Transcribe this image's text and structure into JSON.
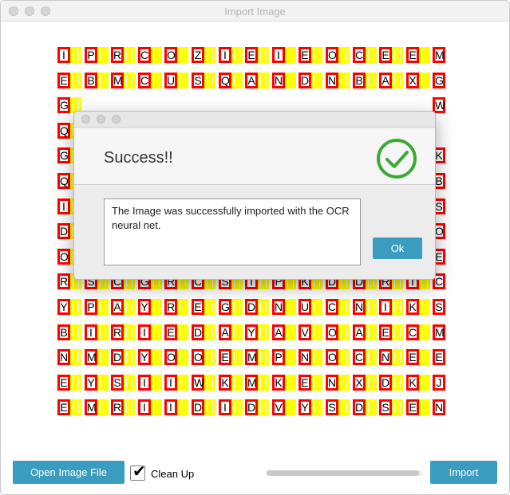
{
  "window": {
    "title": "Import Image"
  },
  "image_grid": {
    "rows": [
      "IPRCOZIEIEOCEEM",
      "EBMCUSQANDNBAXG",
      "GPIISNOGOGEWKW",
      "Q",
      "GK",
      "QB",
      "IS",
      "DO",
      "OE",
      "RSCGRCSIPKDDRIC",
      "YPAYREGDNUCNIKS",
      "BIRIEDAYAVOAECM",
      "NMDYOOEMPNOCNEE",
      "EYSIIWKMKENXDKJ",
      "EMRIIDIDVYSDSEN"
    ],
    "colors": {
      "letter_border": "#ff0000",
      "space_border": "#ffff00"
    }
  },
  "dialog": {
    "heading": "Success!!",
    "message": "The Image was successfully imported with the OCR neural net.",
    "ok_label": "Ok",
    "icon": "check-circle-icon",
    "icon_color": "#3aaa35"
  },
  "controls": {
    "open_label": "Open Image File",
    "cleanup_label": "Clean Up",
    "cleanup_checked": true,
    "import_label": "Import",
    "progress": 0.98,
    "accent": "#3a9cbe"
  }
}
